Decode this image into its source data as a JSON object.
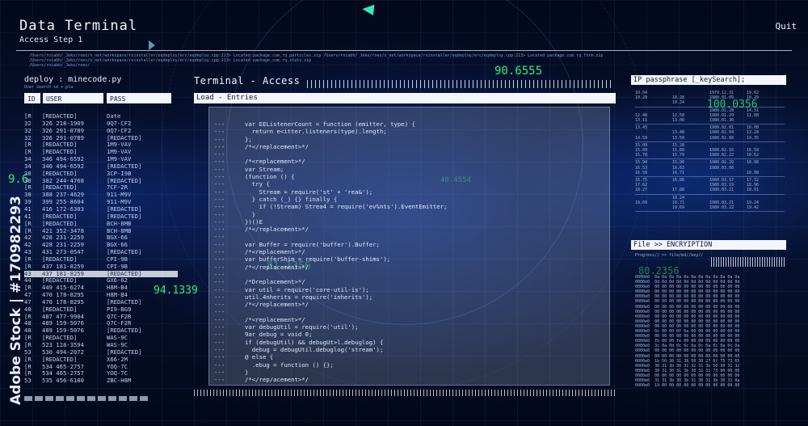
{
  "app": {
    "title": "Data Terminal",
    "subtitle": "Access Step 1",
    "quit_label": "Quit"
  },
  "path_lines": [
    "/Users/roiabh/_Jeko/roes/n_net/workspace/roinstaller/eqdeploy/erc/eqdeploy.cpp:213> Located package.com.rq.particles.zip /Users/roiabh/_Jeko/roes/n_net/workspace/roinstaller/eqdeploy/erc/eqdeploy.cpp:213> Located package.com.rq.form.zip",
    "/Users/roiabh/_Jeko/roes/n_net/workspace/roinstaller/eqdeploy/erc/eqdeploy.cpp:213> Located package.com.rq.stats.zip",
    "/Users/roiabh/_Jeko/roes/"
  ],
  "floating_numbers": {
    "top": "90.6555",
    "right": "100.0356",
    "left": "9.6",
    "mid": "94.1339",
    "center": "81.1356",
    "center2": "40.4554",
    "right2": "80.2356"
  },
  "left_panel": {
    "title": "deploy : minecode.py",
    "hint": "User search id + pla",
    "headers": [
      "ID",
      "USER",
      "PASS"
    ],
    "header_extra": "Date",
    "rows": [
      [
        "[R",
        "[REDACTED]",
        "Date"
      ],
      [
        "32",
        "326 218-1909",
        "0Q7-CF2"
      ],
      [
        "32",
        "326 291-0789",
        "0Q7-CF2"
      ],
      [
        "32",
        "326 291-0789",
        "[REDACTED]"
      ],
      [
        "[R",
        "[REDACTED]",
        "1M9-VAV"
      ],
      [
        "[R",
        "[REDACTED]",
        "1M9-VAV"
      ],
      [
        "34",
        "346 494-6592",
        "1M9-VAV"
      ],
      [
        "34",
        "346 494-6592",
        "[REDACTED]"
      ],
      [
        "38",
        "[REDACTED]",
        "3CP-I9B"
      ],
      [
        "38",
        "382 244-4768",
        "[REDACTED]"
      ],
      [
        "[R",
        "[REDACTED]",
        "7CF-2R"
      ],
      [
        "38",
        "388 237-4629",
        "911-M9V"
      ],
      [
        "39",
        "399 255-8604",
        "911-M9V"
      ],
      [
        "41",
        "416 172-6303",
        "[REDACTED]"
      ],
      [
        "41",
        "[REDACTED]",
        "[REDACTED]"
      ],
      [
        "[R",
        "[REDACTED]",
        "BCH-8MB"
      ],
      [
        "[R",
        "421 352-3478",
        "BCH-8MB"
      ],
      [
        "42",
        "428 231-2259",
        "BGX-66"
      ],
      [
        "42",
        "428 231-2259",
        "BGX-66"
      ],
      [
        "43",
        "431 273-0547",
        "[REDACTED]"
      ],
      [
        "[R",
        "[REDACTED]",
        "CPI-9B"
      ],
      [
        "[R",
        "437 181-8259",
        "CPI-9B"
      ],
      [
        "43",
        "437 181-8259",
        "[REDACTED]"
      ],
      [
        "44",
        "[REDACTED]",
        "GX6-62"
      ],
      [
        "[R",
        "449 415-6274",
        "H8M-B4"
      ],
      [
        "47",
        "470 178-8295",
        "H8M-B4"
      ],
      [
        "47",
        "470 178-8295",
        "[REDACTED]"
      ],
      [
        "48",
        "[REDACTED]",
        "PI9-BG9"
      ],
      [
        "[R",
        "487 477-9904",
        "Q7C-F2R"
      ],
      [
        "48",
        "489 159-5076",
        "Q7C-F2R"
      ],
      [
        "48",
        "489 159-5076",
        "[REDACTED]"
      ],
      [
        "[R",
        "[REDACTED]",
        "WAS-9C"
      ],
      [
        "[R",
        "523 118-3594",
        "WAS-9C"
      ],
      [
        "53",
        "530 494-2072",
        "[REDACTED]"
      ],
      [
        "[R",
        "[REDACTED]",
        "X66-2M"
      ],
      [
        "[R",
        "534 465-2757",
        "YOQ-7C"
      ],
      [
        "[R",
        "534 465-2757",
        "YOQ-7C"
      ],
      [
        "53",
        "535 456-6180",
        "ZBC-H8M"
      ]
    ],
    "selected_index": 22
  },
  "center_panel": {
    "title": "Terminal - Access",
    "bar_label": "Load - Entries",
    "line_marker": "---",
    "code_lines": [
      "var EEListenerCount = function (emitter, type) {",
      "  return e<itter.listeners(type).length;",
      "};",
      "/*</replacement>*/",
      "",
      "/*<replacement>*/",
      "var Stream;",
      "(function () {",
      "  try {",
      "    Stream = require('st' + 'rea&');",
      "  } catch (_) {} finally {",
      "    if (!Stream) Strea4 = require('ev%nts').EventEmitter;",
      "  }",
      "})()E",
      "/*</replacement>*/",
      "",
      "var Buffer = require('buffer').Buffer;",
      "/*<replacement>*/",
      "var bufferShim = require('buffer-shims');",
      "/*</replacement>*/",
      "",
      "/*Dreplacement>*/",
      "var util = require('core-util-is');",
      "util.4nherits = require('inherits');",
      "/*</replacement>*/",
      "",
      "/*<replacement>*/",
      "var debugUtil = require('util');",
      "9ar debug = void 0;",
      "if (debugUtil) && debugUt>l.debuglog) {",
      "  debug = debugUtil.debuglog('stream');",
      "@ else {",
      "  .ebug = function () {};",
      "}",
      "/*</rep/acement>*/",
      "",
      "Zar BufferList = Tequire('./internal/strea"
    ]
  },
  "right_panel": {
    "title": "IP passphrase [_keySearch];",
    "table_rows": [
      [
        "10.04",
        "",
        "1979.12.31",
        "19.02"
      ],
      [
        "10.29",
        "10.28",
        "1980.01.09",
        "10.29"
      ],
      [
        "",
        "10.24",
        "",
        ""
      ],
      [
        "",
        "",
        "1980.01.28",
        "14.31"
      ],
      [
        "12.48",
        "12.58",
        "1980.01.29",
        "11.08"
      ],
      [
        "13.11",
        "13.00",
        "1980.01.30",
        ""
      ],
      [
        "13.45",
        "",
        "1980.02.01",
        "16.08"
      ],
      [
        "",
        "13.48",
        "1980.02.04",
        "13.28"
      ],
      [
        "14.50",
        "13.50",
        "1980.02.08",
        "14.35"
      ],
      [
        "15.09",
        "15.28",
        "",
        ""
      ],
      [
        "15.60",
        "15.80",
        "1980.02.16",
        "16.58"
      ],
      [
        "15.70",
        "15.70",
        "1980.02.22",
        "16.62"
      ],
      [
        "15.94",
        "15.96",
        "1980.02.29",
        "16.96"
      ],
      [
        "16.53",
        "16.63",
        "1980.03.08",
        ""
      ],
      [
        "16.58",
        "16.71",
        "",
        "16.98"
      ],
      [
        "16.75",
        "16.86",
        "1980.03.17",
        "17.32"
      ],
      [
        "17.62",
        "",
        "1980.03.19",
        "18.96"
      ],
      [
        "18.27",
        "17.88",
        "1980.03.21",
        "18.91"
      ],
      [
        "",
        "18.24",
        "",
        ""
      ],
      [
        "19.69",
        "18.71",
        "1980.03.21",
        "19.24"
      ],
      [
        "",
        "19.69",
        "1980.03.22",
        "19.42"
      ]
    ],
    "file_title": "File >> ENCRYIPTION",
    "progress_label": "Progress// >> file/md//key//",
    "hex_lines": [
      "0000e0  0a 0a 0a 0a 0a 0a 0a 0a 0a 0a 0a 0a",
      "0000e0  0d 0d 0d 0d 0d 0d 0d 0d 0d 0d 0d 0d",
      "0000e0  00 00 00 00 00 00 00 00 00 00 00 00",
      "0000e0  00 00 00 00 00 00 00 00 00 00 00 00",
      "0000e0  00 00 00 00 00 00 00 00 00 00 00 00",
      "0000e0  00 00 00 00 00 00 00 00 00 00 00 00",
      "0000e0  00 00 00 00 00 00 00 00 00 00 00 00",
      "0000e0  00 00 00 00 00 00 00 00 00 00 00 00",
      "0000e0  00 00 00 00 00 00 00 00 00 00 00 00",
      "0000e0  00 00 00 00 00 00 00 00 00 00 00 00",
      "0000e0  00 00 00 00 00 00 00 00 00 00 00 00",
      "0000e0  0c 00 00 0f 0a 00 00 00 00 00 00 00",
      "0000e0  00 00 00 00 00 00 00 00 00 00 00 00",
      "0000e0  fb 00 00 fe 00 00 00 00 00 00 00 00",
      "0000e0  3c 0a 0d 0c 0c 0a 0c 0a 0c 0a 0c 0a",
      "0000e0  00 00 00 00 00 00 00 00 00 00 00 00",
      "0000e0  00 00 00 00 00 00 00 00 00 00 00 00",
      "0000e0  1b 50 30 31 38 50 30 27 6f 75 73 65",
      "0000e0  30 31 3b 30 31 32 31 3b 50 30 31 32",
      "0000e0  30 31 30 31 3b 30 32 31 73 00 00 00",
      "0000e0  00 00 00 00 00 00 00 00 00 00 00 00",
      "0000e0  31 31 3b 30 3b 31 30 31 3b 30 31 0a",
      "0000e0  19 00 00 00 00 00 00 00 00 00 00 00"
    ]
  },
  "watermark": {
    "text": "Adobe Stock | #170982293"
  }
}
